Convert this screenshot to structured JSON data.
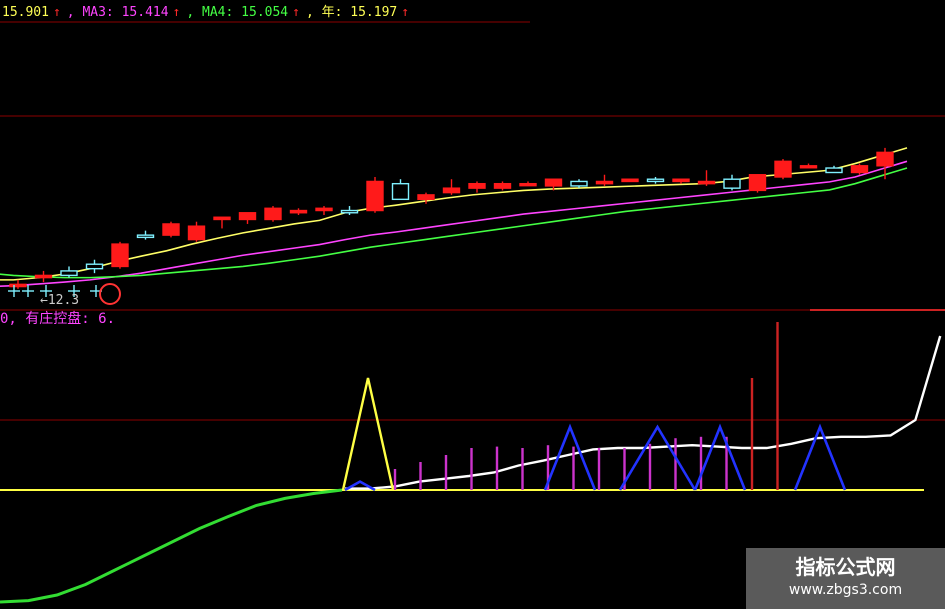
{
  "header": {
    "items": [
      {
        "text": "15.901",
        "color": "#ffff55"
      },
      {
        "text": ", MA3: 15.414",
        "color": "#ff44ff"
      },
      {
        "text": ", MA4: 15.054",
        "color": "#44ff44"
      },
      {
        "text": ", 年: 15.197",
        "color": "#ffff55"
      }
    ],
    "arrow": "↑"
  },
  "subheader": {
    "text": "0, 有庄控盘: 6.",
    "color": "#ff44ff"
  },
  "price_annotation": "←12.3",
  "watermark": {
    "line1": "指标公式网",
    "line2": "www.zbgs3.com"
  },
  "colors": {
    "up": "#ff1a1a",
    "down": "#7ff0ff",
    "grid": "#8b0000"
  },
  "chart_data": [
    {
      "type": "candlestick",
      "candles": [
        {
          "o": 12.9,
          "h": 13.05,
          "l": 12.85,
          "c": 12.95
        },
        {
          "o": 13.1,
          "h": 13.25,
          "l": 13.0,
          "c": 13.15
        },
        {
          "o": 13.25,
          "h": 13.35,
          "l": 13.1,
          "c": 13.15
        },
        {
          "o": 13.4,
          "h": 13.5,
          "l": 13.2,
          "c": 13.3
        },
        {
          "o": 13.35,
          "h": 13.9,
          "l": 13.3,
          "c": 13.85
        },
        {
          "o": 14.05,
          "h": 14.15,
          "l": 13.95,
          "c": 14.0
        },
        {
          "o": 14.05,
          "h": 14.35,
          "l": 14.0,
          "c": 14.3
        },
        {
          "o": 13.95,
          "h": 14.35,
          "l": 13.9,
          "c": 14.25
        },
        {
          "o": 14.4,
          "h": 14.45,
          "l": 14.2,
          "c": 14.45
        },
        {
          "o": 14.4,
          "h": 14.5,
          "l": 14.3,
          "c": 14.55
        },
        {
          "o": 14.4,
          "h": 14.7,
          "l": 14.35,
          "c": 14.65
        },
        {
          "o": 14.55,
          "h": 14.65,
          "l": 14.5,
          "c": 14.6
        },
        {
          "o": 14.6,
          "h": 14.7,
          "l": 14.5,
          "c": 14.65
        },
        {
          "o": 14.6,
          "h": 14.7,
          "l": 14.5,
          "c": 14.55
        },
        {
          "o": 14.6,
          "h": 15.35,
          "l": 14.55,
          "c": 15.25
        },
        {
          "o": 15.2,
          "h": 15.3,
          "l": 14.85,
          "c": 14.85
        },
        {
          "o": 14.85,
          "h": 15.0,
          "l": 14.75,
          "c": 14.95
        },
        {
          "o": 15.0,
          "h": 15.3,
          "l": 14.95,
          "c": 15.1
        },
        {
          "o": 15.1,
          "h": 15.25,
          "l": 15.0,
          "c": 15.2
        },
        {
          "o": 15.1,
          "h": 15.25,
          "l": 15.05,
          "c": 15.2
        },
        {
          "o": 15.2,
          "h": 15.25,
          "l": 15.15,
          "c": 15.2
        },
        {
          "o": 15.15,
          "h": 15.3,
          "l": 15.05,
          "c": 15.3
        },
        {
          "o": 15.25,
          "h": 15.3,
          "l": 15.1,
          "c": 15.15
        },
        {
          "o": 15.2,
          "h": 15.4,
          "l": 15.15,
          "c": 15.25
        },
        {
          "o": 15.25,
          "h": 15.3,
          "l": 15.25,
          "c": 15.3
        },
        {
          "o": 15.3,
          "h": 15.35,
          "l": 15.2,
          "c": 15.25
        },
        {
          "o": 15.25,
          "h": 15.3,
          "l": 15.2,
          "c": 15.3
        },
        {
          "o": 15.2,
          "h": 15.5,
          "l": 15.15,
          "c": 15.25
        },
        {
          "o": 15.3,
          "h": 15.4,
          "l": 15.05,
          "c": 15.1
        },
        {
          "o": 15.05,
          "h": 15.4,
          "l": 15.0,
          "c": 15.4
        },
        {
          "o": 15.35,
          "h": 15.75,
          "l": 15.3,
          "c": 15.7
        },
        {
          "o": 15.6,
          "h": 15.65,
          "l": 15.55,
          "c": 15.6
        },
        {
          "o": 15.55,
          "h": 15.6,
          "l": 15.45,
          "c": 15.45
        },
        {
          "o": 15.45,
          "h": 15.65,
          "l": 15.4,
          "c": 15.6
        },
        {
          "o": 15.6,
          "h": 16.0,
          "l": 15.3,
          "c": 15.9
        }
      ],
      "ma_lines": [
        {
          "color": "#ffff66",
          "values": [
            13.05,
            13.05,
            13.1,
            13.18,
            13.3,
            13.45,
            13.58,
            13.7,
            13.85,
            13.98,
            14.1,
            14.2,
            14.3,
            14.38,
            14.55,
            14.65,
            14.72,
            14.8,
            14.88,
            14.95,
            15.0,
            15.05,
            15.08,
            15.1,
            15.12,
            15.14,
            15.16,
            15.18,
            15.2,
            15.25,
            15.35,
            15.4,
            15.45,
            15.5,
            15.65
          ]
        },
        {
          "color": "#ff44ff",
          "values": [
            12.9,
            12.92,
            12.96,
            13.0,
            13.05,
            13.12,
            13.2,
            13.3,
            13.4,
            13.5,
            13.6,
            13.68,
            13.76,
            13.84,
            13.95,
            14.05,
            14.12,
            14.2,
            14.28,
            14.36,
            14.44,
            14.52,
            14.58,
            14.64,
            14.7,
            14.76,
            14.82,
            14.88,
            14.94,
            15.0,
            15.06,
            15.12,
            15.18,
            15.24,
            15.35
          ]
        },
        {
          "color": "#44ff44",
          "values": [
            13.2,
            13.15,
            13.12,
            13.1,
            13.1,
            13.12,
            13.15,
            13.2,
            13.25,
            13.3,
            13.35,
            13.42,
            13.5,
            13.58,
            13.68,
            13.78,
            13.86,
            13.94,
            14.02,
            14.1,
            14.18,
            14.26,
            14.34,
            14.42,
            14.5,
            14.58,
            14.64,
            14.7,
            14.76,
            14.82,
            14.88,
            14.94,
            15.0,
            15.06,
            15.2
          ]
        }
      ]
    },
    {
      "type": "indicator",
      "white_line": [
        0.02,
        0.02,
        0.05,
        0.12,
        0.16,
        0.2,
        0.25,
        0.35,
        0.42,
        0.5,
        0.58,
        0.6,
        0.6,
        0.62,
        0.64,
        0.62,
        0.6,
        0.6,
        0.66,
        0.74,
        0.76,
        0.76,
        0.78,
        1.0,
        2.2
      ],
      "green_curve": [
        -1.6,
        -1.58,
        -1.5,
        -1.35,
        -1.15,
        -0.95,
        -0.75,
        -0.55,
        -0.38,
        -0.22,
        -0.12,
        -0.05,
        0.0
      ],
      "spike": {
        "peak": 1.6
      },
      "vbar_values": [
        0.3,
        0.4,
        0.5,
        0.6,
        0.62,
        0.6,
        0.64,
        0.62,
        0.6,
        0.6,
        0.66,
        0.74,
        0.76,
        0.76,
        1.6,
        2.4
      ]
    }
  ]
}
